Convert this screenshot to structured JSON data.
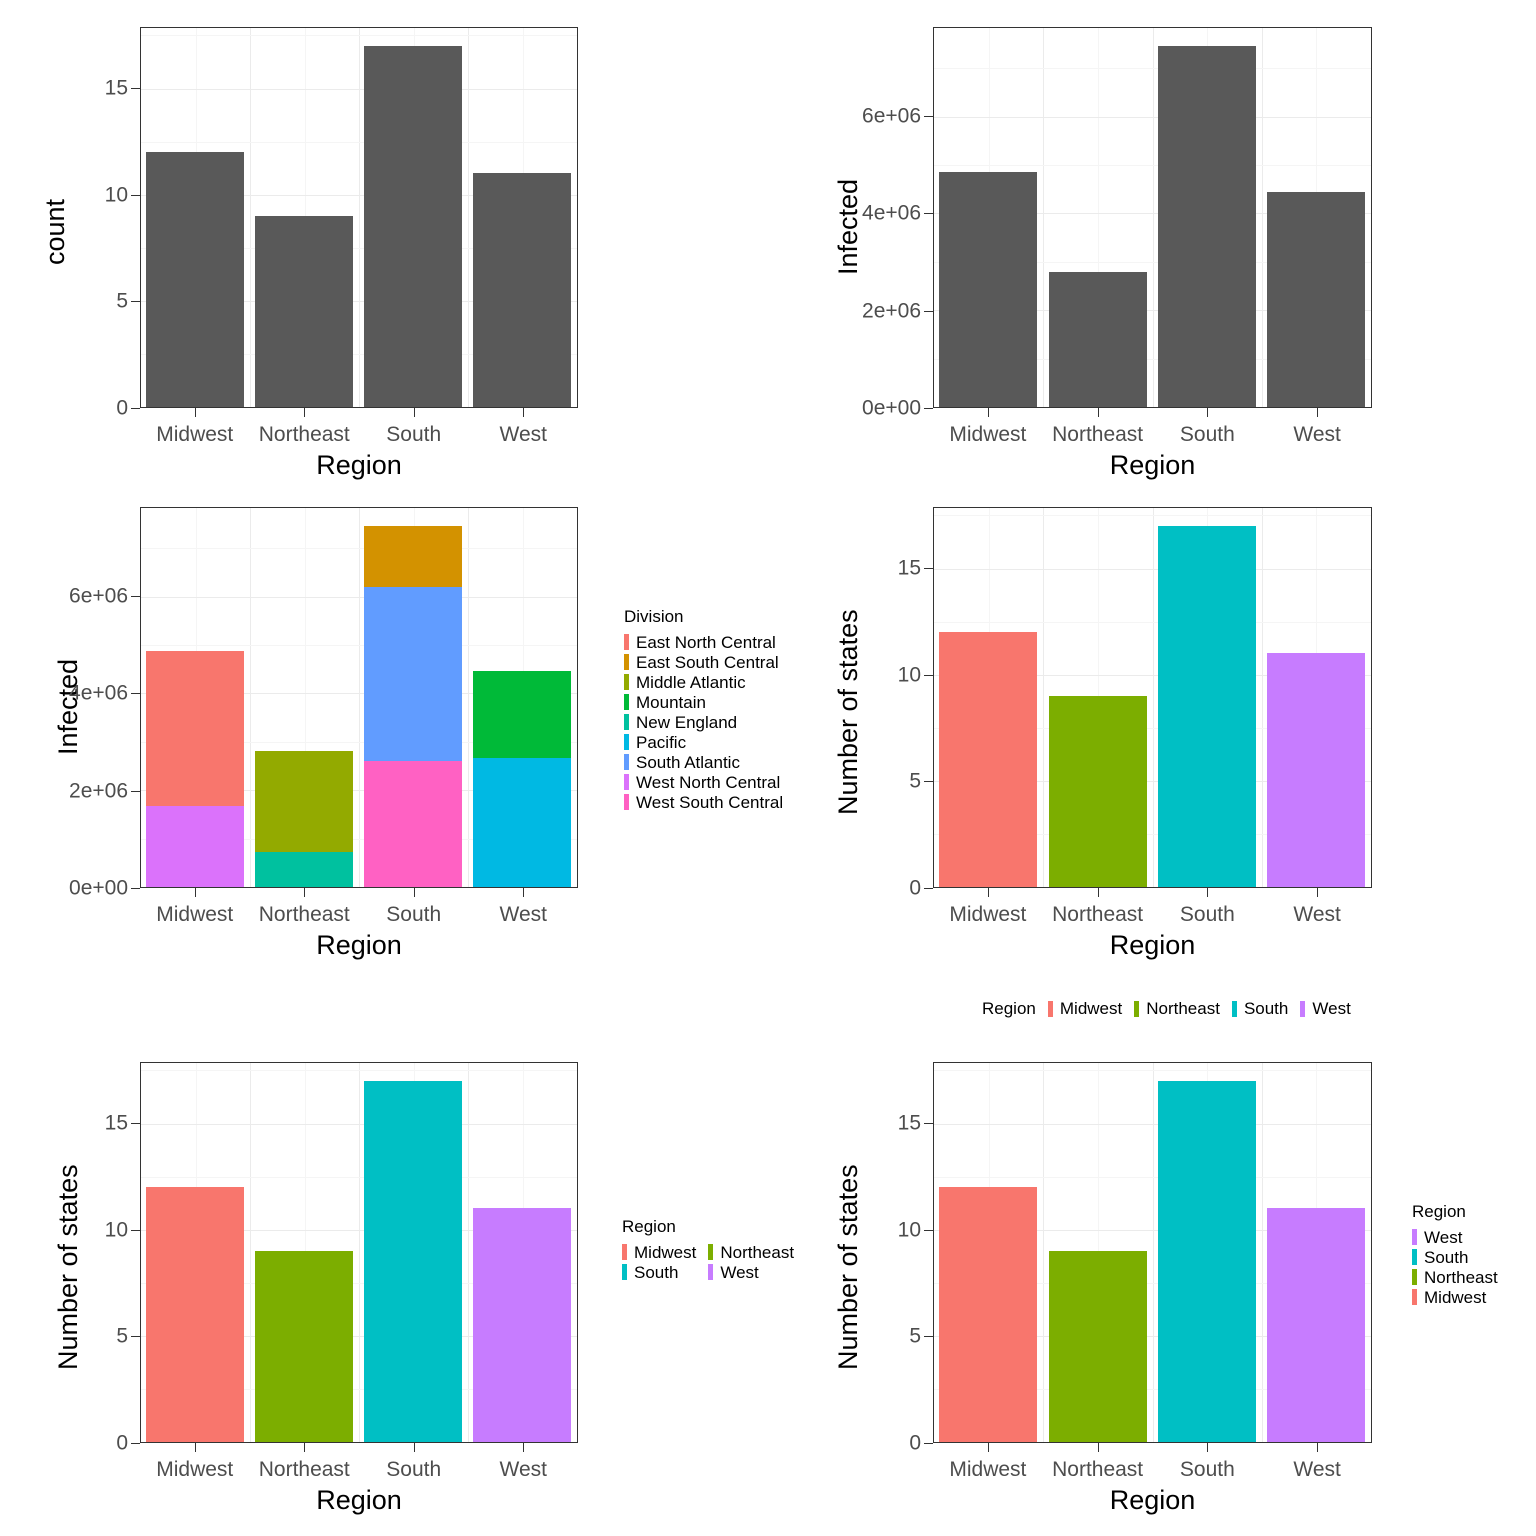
{
  "palette": {
    "grey_bar": "#595959",
    "region": {
      "Midwest": "#F8766D",
      "Northeast": "#7CAE00",
      "South": "#00BFC4",
      "West": "#C77CFF"
    },
    "division": {
      "East North Central": "#F8766D",
      "East South Central": "#D39200",
      "Middle Atlantic": "#93AA00",
      "Mountain": "#00BA38",
      "New England": "#00C19F",
      "Pacific": "#00B9E3",
      "South Atlantic": "#619CFF",
      "West North Central": "#DB72FB",
      "West South Central": "#FF61C3"
    },
    "panel_border": "#333333",
    "gridline_major": "#EBEBEB",
    "gridline_minor": "#F5F5F5",
    "axis_text": "#4D4D4D",
    "axis_title": "#000000"
  },
  "chart_data": [
    {
      "id": "panel-1",
      "type": "bar",
      "title": "",
      "xlabel": "Region",
      "ylabel": "count",
      "categories": [
        "Midwest",
        "Northeast",
        "South",
        "West"
      ],
      "values": [
        12,
        9,
        17,
        11
      ],
      "ylim": [
        0,
        17.85
      ],
      "yticks": [
        0,
        5,
        10,
        15
      ],
      "ytick_labels": [
        "0",
        "5",
        "10",
        "15"
      ],
      "grid": true,
      "legend": null,
      "fill": "uniform-grey"
    },
    {
      "id": "panel-2",
      "type": "bar",
      "title": "",
      "xlabel": "Region",
      "ylabel": "Infected",
      "categories": [
        "Midwest",
        "Northeast",
        "South",
        "West"
      ],
      "values": [
        4860000,
        2790000,
        7460000,
        4440000
      ],
      "ylim": [
        0,
        7833000
      ],
      "yticks": [
        0,
        2000000,
        4000000,
        6000000
      ],
      "ytick_labels": [
        "0e+00",
        "2e+06",
        "4e+06",
        "6e+06"
      ],
      "grid": true,
      "legend": null,
      "fill": "uniform-grey"
    },
    {
      "id": "panel-3",
      "type": "bar",
      "subtype": "stacked",
      "title": "",
      "xlabel": "Region",
      "ylabel": "Infected",
      "categories": [
        "Midwest",
        "Northeast",
        "South",
        "West"
      ],
      "ylim": [
        0,
        7833000
      ],
      "yticks": [
        0,
        2000000,
        4000000,
        6000000
      ],
      "ytick_labels": [
        "0e+00",
        "2e+06",
        "4e+06",
        "6e+06"
      ],
      "grid": true,
      "series": [
        {
          "name": "East North Central",
          "values": [
            3190000,
            0,
            0,
            0
          ]
        },
        {
          "name": "East South Central",
          "values": [
            0,
            0,
            1250000,
            0
          ]
        },
        {
          "name": "Middle Atlantic",
          "values": [
            0,
            2070000,
            0,
            0
          ]
        },
        {
          "name": "Mountain",
          "values": [
            0,
            0,
            0,
            1780000
          ]
        },
        {
          "name": "New England",
          "values": [
            0,
            720000,
            0,
            0
          ]
        },
        {
          "name": "Pacific",
          "values": [
            0,
            0,
            0,
            2660000
          ]
        },
        {
          "name": "South Atlantic",
          "values": [
            0,
            0,
            3600000,
            0
          ]
        },
        {
          "name": "West North Central",
          "values": [
            1670000,
            0,
            0,
            0
          ]
        },
        {
          "name": "West South Central",
          "values": [
            0,
            0,
            2610000,
            0
          ]
        }
      ],
      "legend": {
        "title": "Division",
        "position": "right",
        "direction": "vertical",
        "entries": [
          "East North Central",
          "East South Central",
          "Middle Atlantic",
          "Mountain",
          "New England",
          "Pacific",
          "South Atlantic",
          "West North Central",
          "West South Central"
        ]
      }
    },
    {
      "id": "panel-4",
      "type": "bar",
      "title": "",
      "xlabel": "Region",
      "ylabel": "Number of states",
      "categories": [
        "Midwest",
        "Northeast",
        "South",
        "West"
      ],
      "values": [
        12,
        9,
        17,
        11
      ],
      "ylim": [
        0,
        17.85
      ],
      "yticks": [
        0,
        5,
        10,
        15
      ],
      "ytick_labels": [
        "0",
        "5",
        "10",
        "15"
      ],
      "grid": true,
      "fill": "by-region",
      "legend": {
        "title": "Region",
        "position": "bottom",
        "direction": "horizontal",
        "entries": [
          "Midwest",
          "Northeast",
          "South",
          "West"
        ]
      }
    },
    {
      "id": "panel-5",
      "type": "bar",
      "title": "",
      "xlabel": "Region",
      "ylabel": "Number of states",
      "categories": [
        "Midwest",
        "Northeast",
        "South",
        "West"
      ],
      "values": [
        12,
        9,
        17,
        11
      ],
      "ylim": [
        0,
        17.85
      ],
      "yticks": [
        0,
        5,
        10,
        15
      ],
      "ytick_labels": [
        "0",
        "5",
        "10",
        "15"
      ],
      "grid": true,
      "fill": "by-region",
      "legend": {
        "title": "Region",
        "position": "right",
        "direction": "grid-2col",
        "entries": [
          "Midwest",
          "Northeast",
          "South",
          "West"
        ]
      }
    },
    {
      "id": "panel-6",
      "type": "bar",
      "title": "",
      "xlabel": "Region",
      "ylabel": "Number of states",
      "categories": [
        "Midwest",
        "Northeast",
        "South",
        "West"
      ],
      "values": [
        12,
        9,
        17,
        11
      ],
      "ylim": [
        0,
        17.85
      ],
      "yticks": [
        0,
        5,
        10,
        15
      ],
      "ytick_labels": [
        "0",
        "5",
        "10",
        "15"
      ],
      "grid": true,
      "fill": "by-region",
      "legend": {
        "title": "Region",
        "position": "right",
        "direction": "vertical-reversed",
        "entries": [
          "West",
          "South",
          "Northeast",
          "Midwest"
        ]
      }
    }
  ]
}
